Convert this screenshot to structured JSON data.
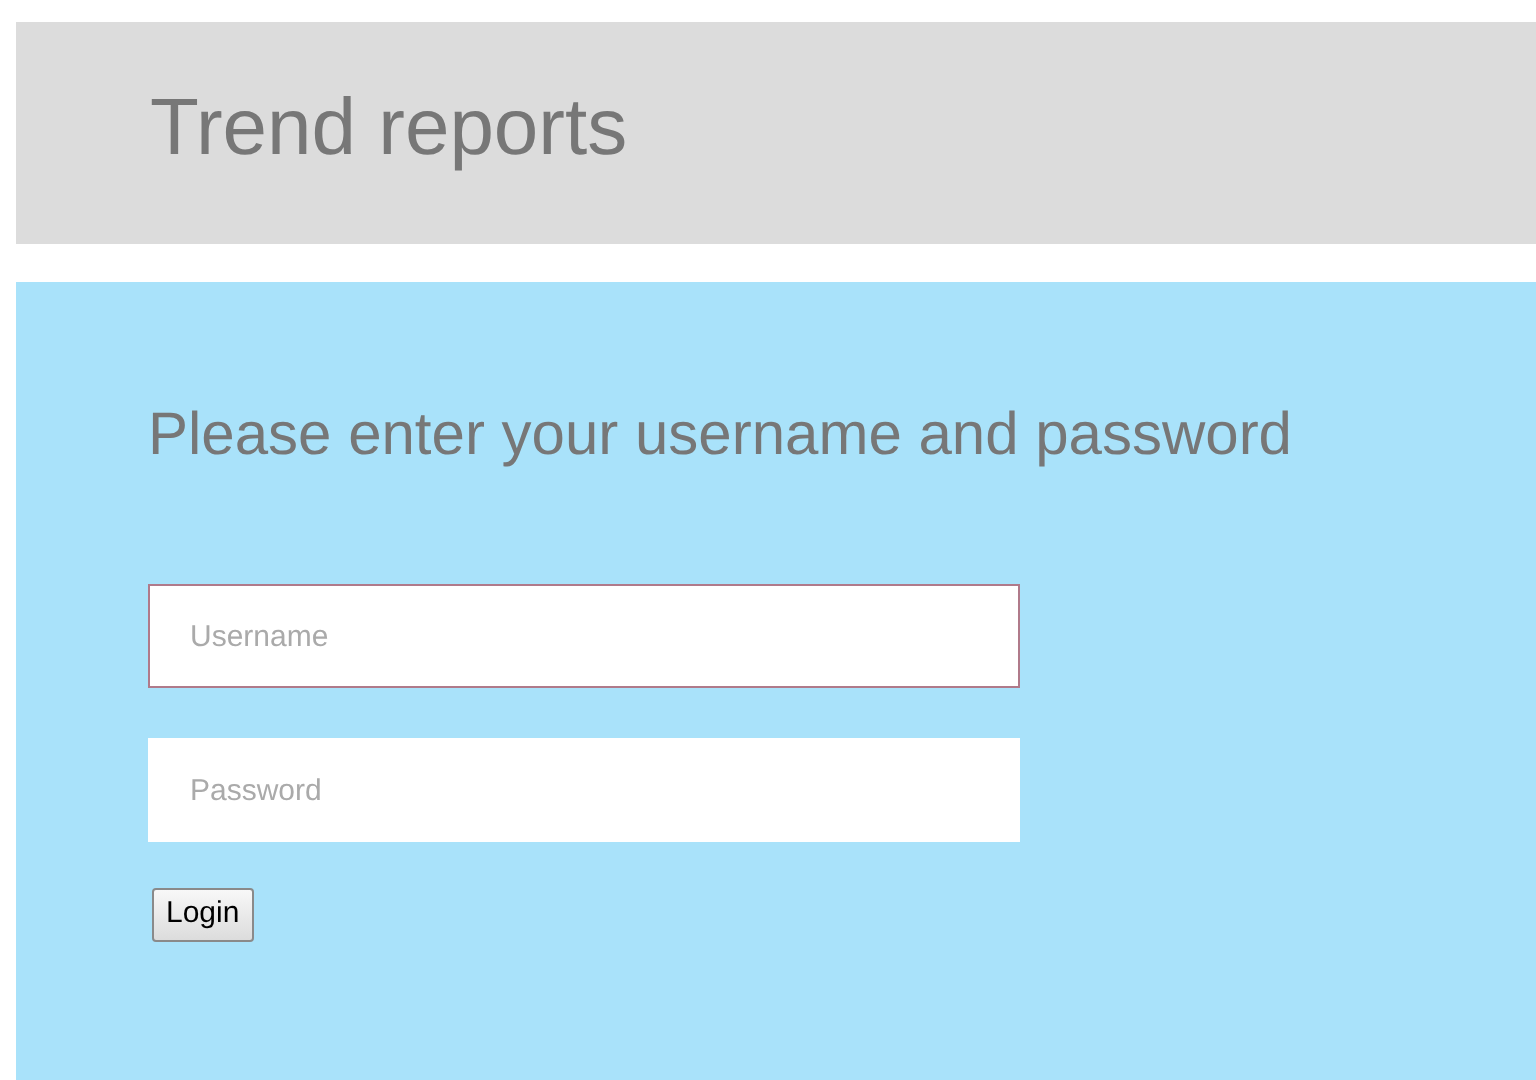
{
  "header": {
    "title": "Trend reports"
  },
  "login": {
    "heading": "Please enter your username and password",
    "fields": [
      {
        "placeholder": "Username",
        "focused": true
      },
      {
        "placeholder": "Password",
        "focused": false
      }
    ],
    "button": "Login"
  }
}
